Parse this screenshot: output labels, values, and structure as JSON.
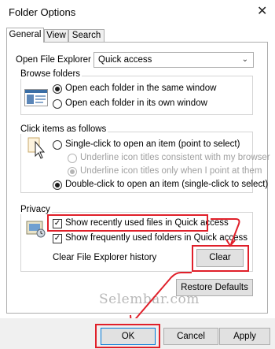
{
  "window": {
    "title": "Folder Options",
    "close_glyph": "✕"
  },
  "tabs": [
    {
      "label": "General",
      "active": true
    },
    {
      "label": "View",
      "active": false
    },
    {
      "label": "Search",
      "active": false
    }
  ],
  "open_explorer": {
    "label": "Open File Explorer to:",
    "value": "Quick access"
  },
  "browse_folders": {
    "legend": "Browse folders",
    "options": [
      {
        "label": "Open each folder in the same window",
        "selected": true
      },
      {
        "label": "Open each folder in its own window",
        "selected": false
      }
    ]
  },
  "click_items": {
    "legend": "Click items as follows",
    "single": {
      "label": "Single-click to open an item (point to select)",
      "selected": false
    },
    "sub_options": [
      {
        "label": "Underline icon titles consistent with my browser",
        "selected": false
      },
      {
        "label": "Underline icon titles only when I point at them",
        "selected": true
      }
    ],
    "double": {
      "label": "Double-click to open an item (single-click to select)",
      "selected": true
    }
  },
  "privacy": {
    "legend": "Privacy",
    "show_recent_files": {
      "label": "Show recently used files in Quick access",
      "checked": true
    },
    "show_frequent_folders": {
      "label": "Show frequently used folders in Quick access",
      "checked": true
    },
    "clear_history_label": "Clear File Explorer history",
    "clear_button": "Clear"
  },
  "restore_defaults_button": "Restore Defaults",
  "watermark": "Selembar.com",
  "footer": {
    "ok": "OK",
    "cancel": "Cancel",
    "apply": "Apply"
  },
  "colors": {
    "highlight": "#e0202a",
    "button": "#e1e1e1",
    "footer_bg": "#f0f0f0"
  }
}
